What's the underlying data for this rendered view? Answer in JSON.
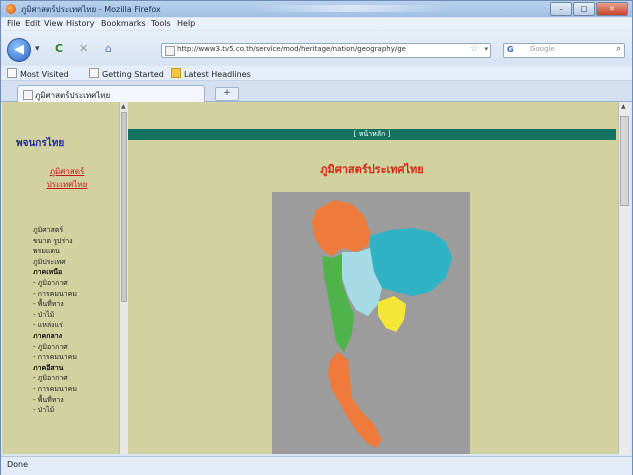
{
  "window": {
    "title": "ภูมิศาสตร์ประเทศไทย - Mozilla Firefox",
    "controls": {
      "minimize": "–",
      "maximize": "□",
      "close": "✕"
    }
  },
  "menu": [
    "File",
    "Edit",
    "View",
    "History",
    "Bookmarks",
    "Tools",
    "Help"
  ],
  "toolbar": {
    "back": "◀",
    "back_dropdown": "▾",
    "reload": "C",
    "stop": "✕",
    "home": "⌂",
    "url": "http://www3.tv5.co.th/service/mod/heritage/nation/geography/ge",
    "star": "☆",
    "url_dropdown": "▾",
    "search_engine": "G",
    "search_placeholder": "Google",
    "search_icon": "⌕"
  },
  "bookmarks": {
    "most_visited": "Most Visited",
    "getting_started": "Getting Started",
    "latest_headlines": "Latest Headlines"
  },
  "tab": {
    "label": "ภูมิศาสตร์ประเทศไทย",
    "new_tab": "+"
  },
  "left_frame": {
    "title": "พจนกรไทย",
    "link": "ภูมิศาสตร์ประเทศไทย",
    "nav": [
      {
        "text": "ภูมิศาสตร์",
        "head": false
      },
      {
        "text": "ขนาด รูปร่าง",
        "head": false
      },
      {
        "text": "พรมแดน",
        "head": false
      },
      {
        "text": "ภูมิประเทศ",
        "head": false
      },
      {
        "text": "ภาคเหนือ",
        "head": true
      },
      {
        "text": "- ภูมิอากาศ",
        "head": false
      },
      {
        "text": "- การคมนาคม",
        "head": false
      },
      {
        "text": "- พื้นที่ทาง",
        "head": false
      },
      {
        "text": "- ป่าไม้",
        "head": false
      },
      {
        "text": "- แหล่งแร่",
        "head": false
      },
      {
        "text": "ภาคกลาง",
        "head": true
      },
      {
        "text": "- ภูมิอากาศ",
        "head": false
      },
      {
        "text": "- การคมนาคม",
        "head": false
      },
      {
        "text": "ภาคอีสาน",
        "head": true
      },
      {
        "text": "- ภูมิอากาศ",
        "head": false
      },
      {
        "text": "- การคมนาคม",
        "head": false
      },
      {
        "text": "- พื้นที่ทาง",
        "head": false
      },
      {
        "text": "- ป่าไม้",
        "head": false
      }
    ]
  },
  "main_frame": {
    "header_bar": "[ หน้าหลัก ]",
    "title": "ภูมิศาสตร์ประเทศไทย",
    "map_colors": {
      "north": "#ee7a3c",
      "northeast": "#2fb3c4",
      "central": "#8fd3e0",
      "west": "#4db34a",
      "east": "#f3e637",
      "south": "#ee7a3c"
    }
  },
  "status": "Done"
}
